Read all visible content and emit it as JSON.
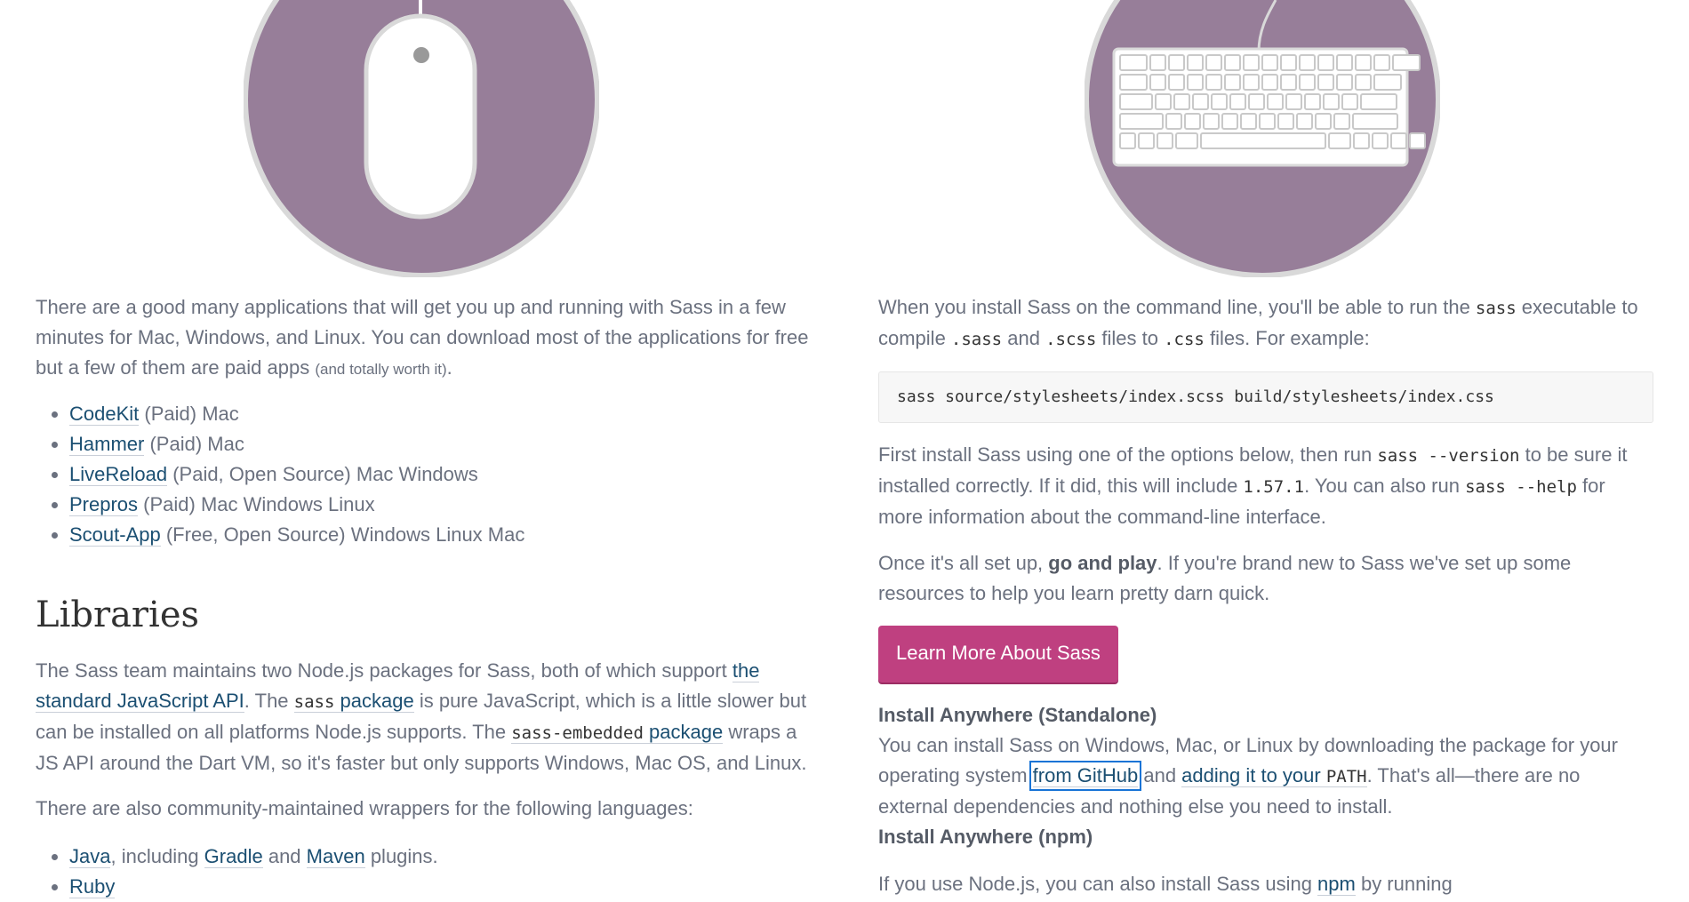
{
  "left": {
    "intro": {
      "text": "There are a good many applications that will get you up and running with Sass in a few minutes for Mac, Windows, and Linux. You can download most of the applications for free but a few of them are paid apps",
      "aside": "(and totally worth it)",
      "end": "."
    },
    "apps": [
      {
        "name": "CodeKit",
        "note": "(Paid) Mac"
      },
      {
        "name": "Hammer",
        "note": "(Paid) Mac"
      },
      {
        "name": "LiveReload",
        "note": "(Paid, Open Source) Mac Windows"
      },
      {
        "name": "Prepros",
        "note": "(Paid) Mac Windows Linux"
      },
      {
        "name": "Scout-App",
        "note": "(Free, Open Source) Windows Linux Mac"
      }
    ],
    "libraries": {
      "heading": "Libraries",
      "p1": {
        "a": "The Sass team maintains two Node.js packages for Sass, both of which support ",
        "link1": "the standard JavaScript API",
        "b": ". The ",
        "link2_code": "sass",
        "link2_text": " package",
        "c": " is pure JavaScript, which is a little slower but can be installed on all platforms Node.js supports. The ",
        "link3_code": "sass-embedded",
        "link3_text": " package",
        "d": " wraps a JS API around the Dart VM, so it's faster but only supports Windows, Mac OS, and Linux."
      },
      "p2": "There are also community-maintained wrappers for the following languages:",
      "wrappers": {
        "java": "Java",
        "java_text1": ", including ",
        "gradle": "Gradle",
        "java_text2": " and ",
        "maven": "Maven",
        "java_text3": " plugins.",
        "ruby": "Ruby"
      }
    }
  },
  "right": {
    "p1": {
      "a": "When you install Sass on the command line, you'll be able to run the ",
      "code1": "sass",
      "b": " executable to compile ",
      "code2": ".sass",
      "c": " and ",
      "code3": ".scss",
      "d": " files to ",
      "code4": ".css",
      "e": " files. For example:"
    },
    "command": "sass source/stylesheets/index.scss build/stylesheets/index.css",
    "p2": {
      "a": "First install Sass using one of the options below, then run ",
      "code1": "sass --version",
      "b": " to be sure it installed correctly. If it did, this will include ",
      "code2": "1.57.1",
      "c": ". You can also run ",
      "code3": "sass --help",
      "d": " for more information about the command-line interface."
    },
    "p3": {
      "a": "Once it's all set up, ",
      "strong": "go and play",
      "b": ". If you're brand new to Sass we've set up some resources to help you learn pretty darn quick."
    },
    "button": "Learn More About Sass",
    "standalone": {
      "heading": "Install Anywhere (Standalone)",
      "a": "You can install Sass on Windows, Mac, or Linux by downloading the package for your operating system ",
      "link1": "from GitHub",
      "b": " and ",
      "link2": "adding it to your ",
      "link2_code": "PATH",
      "c": ". That's all—there are no external dependencies and nothing else you need to install."
    },
    "npm": {
      "heading": "Install Anywhere (npm)",
      "a": "If you use Node.js, you can also install Sass using ",
      "link": "npm",
      "b": " by running"
    }
  },
  "colors": {
    "accent": "#bf4080",
    "illustration": "#977e99",
    "link": "#1b4f72",
    "text": "#6b717f"
  },
  "icons": [
    "mouse-illustration",
    "keyboard-illustration"
  ]
}
